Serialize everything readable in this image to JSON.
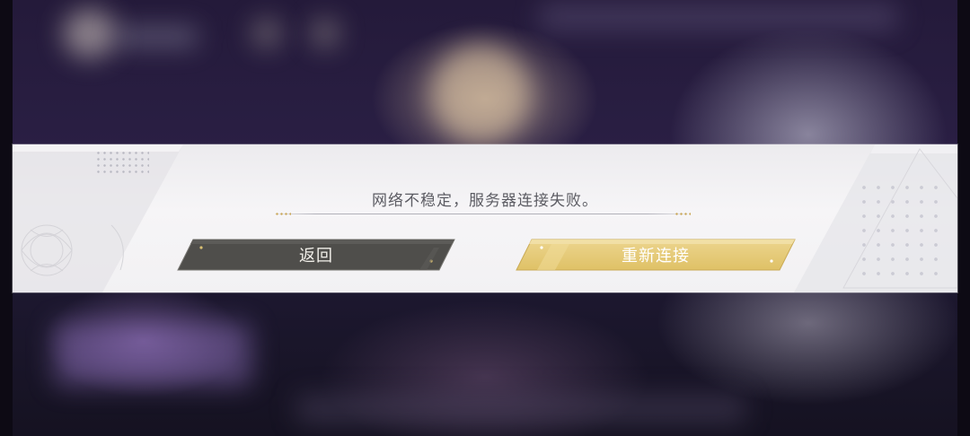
{
  "dialog": {
    "message": "网络不稳定，服务器连接失败。",
    "buttons": {
      "back_label": "返回",
      "reconnect_label": "重新连接"
    }
  },
  "colors": {
    "dialog_bg": "#f4f3f5",
    "message_text": "#5c5c63",
    "back_button": "#4f4e4b",
    "reconnect_button": "#e3c773",
    "gold_accent": "#c9a655"
  }
}
